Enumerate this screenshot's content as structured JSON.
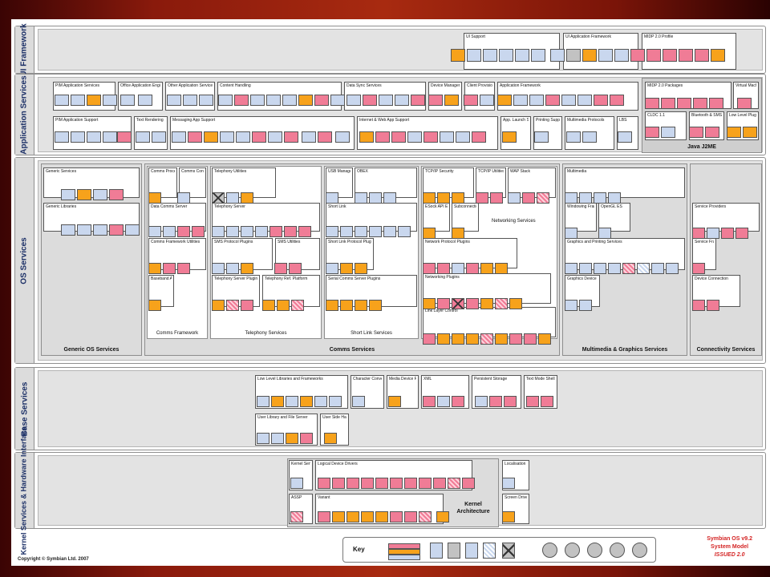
{
  "layers": {
    "ui": "UI Framework",
    "app": "Application Services",
    "os": "OS Services",
    "base": "Base Services",
    "kernel": "Kernel Services & Hardware Interface"
  },
  "ui_framework": {
    "ui_support": "UI Support",
    "ui_app_fw": "UI Application Framework",
    "midp_profile": "MIDP 2.0 Profile",
    "tiles": [
      "Graphics Effects",
      "Animation",
      "Font",
      "Clock",
      "BMP Anim",
      "Grid",
      "Uikon",
      "UIKON Core",
      "FEP Base"
    ]
  },
  "application_services": {
    "pim_app_services": "PIM Application Services",
    "office_engines": "Office Application Engines",
    "other_app_services": "Other Application Services",
    "content_handling": "Content Handling",
    "data_sync": "Data Sync Services",
    "device_mgmt": "Device Management",
    "client_prov": "Client Provisioning",
    "app_framework": "Application Framework",
    "pim_app_support": "PIM Application Support",
    "text_rendering": "Text Rendering",
    "messaging_app": "Messaging App Support",
    "internet_web": "Internet & Web App Support",
    "app_launch": "App. Launch Services",
    "printing_support": "Printing Support",
    "multimedia_protocols": "Multimedia Protocols",
    "lbs": "LBS",
    "midp_packages": "MIDP 2.0 Packages",
    "cldc": "CLDC 1.1",
    "bt_sms": "Bluetooth & SMS Push",
    "low_level_plugins": "Low Level Plugins",
    "virtual_machine": "Virtual Machine",
    "java_j2me": "Java J2ME",
    "tiles": [
      "Calendar",
      "Agenda Model",
      "Contacts Model",
      "Sheet Engine",
      "Word Engine",
      "Help",
      "Alarm",
      "Timezone",
      "Recognizer",
      "MIME",
      "DRM",
      "Sync",
      "Device Mgmt",
      "Client Prov",
      "App Arch",
      "View Srv"
    ]
  },
  "os_services": {
    "generic_services": "Generic Services",
    "generic_libraries": "Generic Libraries",
    "generic_os": "Generic OS Services",
    "comms_process": "Comms Process and Settings",
    "comms_config": "Comms Config. Utils",
    "data_comms": "Data Comms Server",
    "comms_fw_utils": "Comms Framework Utilities",
    "baseband": "Baseband Abstraction",
    "comms_framework": "Comms Framework",
    "telephony_utilities": "Telephony Utilities",
    "telephony_server": "Telephony Server",
    "sms_protocol": "SMS Protocol Plugins",
    "sms_utilities": "SMS Utilities",
    "tel_server_plugins": "Telephony Server Plugins",
    "tel_ref_platform": "Telephony Ref. Platform",
    "telephony_services": "Telephony Services",
    "usb_manager": "USB Manager",
    "obex": "OBEX",
    "short_link": "Short Link",
    "short_link_protocol": "Short Link Protocol Plugins",
    "serial_comms": "Serial Comms Server Plugins",
    "short_link_services": "Short Link Services",
    "tcpip_security": "TCP/IP Security",
    "tcpip_utilities": "TCP/IP Utilities",
    "wap_stack": "WAP Stack",
    "esock_api": "ESock API Extensions",
    "subconnection": "Subconnection Interface",
    "networking_services": "Networking Services",
    "network_protocol": "Network Protocol Plugins",
    "networking_plugins": "Networking Plugins",
    "link_layer": "Link Layer Control",
    "comms_services": "Comms Services",
    "multimedia": "Multimedia",
    "windowing": "Windowing Framework",
    "opengl": "OpenGL ES",
    "graphics_printing": "Graphics and Printing Services",
    "graphics_device": "Graphics Device Interface",
    "multimedia_graphics": "Multimedia & Graphics Services",
    "service_providers": "Service Providers",
    "service_framework": "Service Framework",
    "device_connection": "Device Connection",
    "connectivity_services": "Connectivity Services"
  },
  "base_services": {
    "low_level_libs": "Low Level Libraries and Frameworks",
    "char_conversion": "Character Conversion",
    "media_device": "Media Device Framework",
    "xml": "XML",
    "persistent_storage": "Persistent Storage",
    "text_mode_shell": "Text Mode Shell",
    "user_library": "User Library and File Server",
    "user_side_hal": "User Side Hardware Abstraction"
  },
  "kernel_services": {
    "kernel_services": "Kernel Services",
    "logical_device_drivers": "Logical Device Drivers",
    "localisation": "Localisation",
    "assp": "ASSP",
    "variant": "Variant",
    "kernel_architecture": "Kernel Architecture",
    "screen_driver": "Screen Driver"
  },
  "footer": {
    "key_label": "Key",
    "title_lines": [
      "Symbian OS v9.2",
      "System Model",
      "ISSUED 2.0"
    ],
    "copyright": "Copyright © Symbian Ltd. 2007"
  },
  "colors": {
    "blue_tile": "#c9d7ee",
    "pink_tile": "#f07c96",
    "orange_tile": "#f7a21b",
    "layer_title": "#1b2f66",
    "issued_red": "#d42424"
  }
}
